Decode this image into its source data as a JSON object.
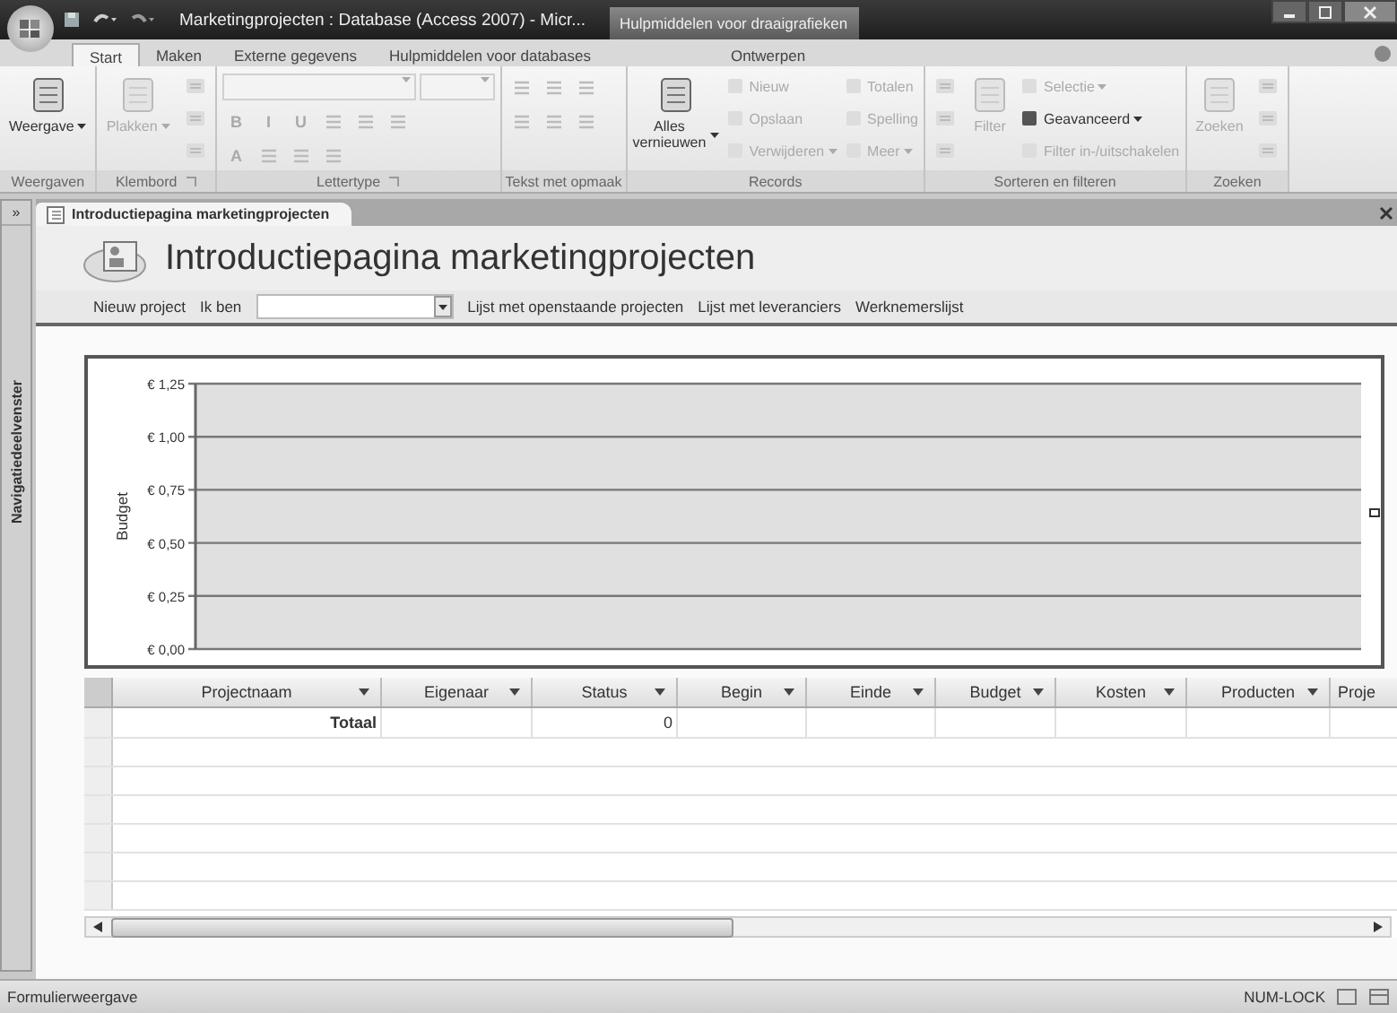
{
  "window": {
    "title": "Marketingprojecten : Database (Access 2007) - Micr...",
    "contextual_tab": "Hulpmiddelen voor draaigrafieken"
  },
  "ribbon_tabs": [
    {
      "label": "Start",
      "selected": true
    },
    {
      "label": "Maken",
      "selected": false
    },
    {
      "label": "Externe gegevens",
      "selected": false
    },
    {
      "label": "Hulpmiddelen voor databases",
      "selected": false
    },
    {
      "label": "Ontwerpen",
      "selected": false
    }
  ],
  "ribbon_groups": [
    {
      "label": "Weergaven",
      "launcher": false,
      "columns": [
        [
          {
            "kind": "large",
            "label": "Weergave",
            "dropdown": true,
            "disabled": false
          }
        ]
      ]
    },
    {
      "label": "Klembord",
      "launcher": true,
      "columns": [
        [
          {
            "kind": "large",
            "label": "Plakken",
            "dropdown": true,
            "disabled": true
          }
        ],
        [
          {
            "kind": "icon",
            "disabled": true
          },
          {
            "kind": "icon",
            "disabled": true
          },
          {
            "kind": "icon",
            "disabled": true
          }
        ]
      ]
    },
    {
      "label": "Lettertype",
      "launcher": true,
      "columns": [
        [
          {
            "kind": "toolrow",
            "items": [
              {
                "kind": "font-combo",
                "disabled": true
              },
              {
                "kind": "size-combo",
                "disabled": true
              }
            ]
          },
          {
            "kind": "toolrow",
            "items": [
              {
                "kind": "glyph",
                "text": "B",
                "disabled": true
              },
              {
                "kind": "glyph",
                "text": "I",
                "disabled": true
              },
              {
                "kind": "glyph",
                "text": "U",
                "disabled": true
              },
              {
                "kind": "icon",
                "disabled": true
              },
              {
                "kind": "icon",
                "disabled": true
              },
              {
                "kind": "icon",
                "disabled": true
              }
            ]
          },
          {
            "kind": "toolrow",
            "items": [
              {
                "kind": "glyph",
                "text": "A",
                "disabled": true
              },
              {
                "kind": "icon",
                "disabled": true
              },
              {
                "kind": "icon",
                "disabled": true
              },
              {
                "kind": "icon",
                "disabled": true
              }
            ]
          }
        ]
      ]
    },
    {
      "label": "Tekst met opmaak",
      "launcher": false,
      "columns": [
        [
          {
            "kind": "toolrow",
            "items": [
              {
                "kind": "icon",
                "disabled": true
              },
              {
                "kind": "icon",
                "disabled": true
              },
              {
                "kind": "icon",
                "disabled": true
              }
            ]
          },
          {
            "kind": "toolrow",
            "items": [
              {
                "kind": "icon",
                "disabled": true
              },
              {
                "kind": "icon",
                "disabled": true
              },
              {
                "kind": "icon",
                "disabled": true
              }
            ]
          }
        ]
      ]
    },
    {
      "label": "Records",
      "launcher": false,
      "columns": [
        [
          {
            "kind": "large",
            "label": "Alles vernieuwen",
            "dropdown": true,
            "disabled": false
          }
        ],
        [
          {
            "kind": "small",
            "label": "Nieuw",
            "dropdown": false,
            "disabled": true
          },
          {
            "kind": "small",
            "label": "Opslaan",
            "dropdown": false,
            "disabled": true
          },
          {
            "kind": "small",
            "label": "Verwijderen",
            "dropdown": true,
            "disabled": true
          }
        ],
        [
          {
            "kind": "small",
            "label": "Totalen",
            "dropdown": false,
            "disabled": true
          },
          {
            "kind": "small",
            "label": "Spelling",
            "dropdown": false,
            "disabled": true
          },
          {
            "kind": "small",
            "label": "Meer",
            "dropdown": true,
            "disabled": true
          }
        ]
      ]
    },
    {
      "label": "Sorteren en filteren",
      "launcher": false,
      "columns": [
        [
          {
            "kind": "icon",
            "disabled": true
          },
          {
            "kind": "icon",
            "disabled": true
          },
          {
            "kind": "icon",
            "disabled": true
          }
        ],
        [
          {
            "kind": "large",
            "label": "Filter",
            "dropdown": false,
            "disabled": true
          }
        ],
        [
          {
            "kind": "small",
            "label": "Selectie",
            "dropdown": true,
            "disabled": true
          },
          {
            "kind": "small",
            "label": "Geavanceerd",
            "dropdown": true,
            "disabled": false
          },
          {
            "kind": "small",
            "label": "Filter in-/uitschakelen",
            "dropdown": false,
            "disabled": true
          }
        ]
      ]
    },
    {
      "label": "Zoeken",
      "launcher": false,
      "columns": [
        [
          {
            "kind": "large",
            "label": "Zoeken",
            "dropdown": false,
            "disabled": true
          }
        ],
        [
          {
            "kind": "icon",
            "disabled": true
          },
          {
            "kind": "icon",
            "disabled": true
          },
          {
            "kind": "icon",
            "disabled": true
          }
        ]
      ]
    }
  ],
  "nav_pane": {
    "toggle": "»",
    "label": "Navigatiedeelvenster"
  },
  "document_tab": {
    "label": "Introductiepagina marketingprojecten"
  },
  "form": {
    "title": "Introductiepagina marketingprojecten",
    "links": [
      {
        "kind": "link",
        "label": "Nieuw project"
      },
      {
        "kind": "label",
        "label": "Ik ben"
      },
      {
        "kind": "combo"
      },
      {
        "kind": "link",
        "label": "Lijst met openstaande projecten"
      },
      {
        "kind": "link",
        "label": "Lijst met leveranciers"
      },
      {
        "kind": "link",
        "label": "Werknemerslijst"
      }
    ],
    "chart": {
      "chart_data": {
        "type": "bar",
        "categories": [
          null
        ],
        "values": [
          null
        ],
        "ylabel": "Budget",
        "grid": true,
        "ylim": [
          0,
          1.25
        ],
        "yticks": [
          {
            "value": 0,
            "label": "€ 0,00"
          },
          {
            "value": 0.25,
            "label": "€ 0,25"
          },
          {
            "value": 0.5,
            "label": "€ 0,50"
          },
          {
            "value": 0.75,
            "label": "€ 0,75"
          },
          {
            "value": 1,
            "label": "€ 1,00"
          },
          {
            "value": 1.25,
            "label": "€ 1,25"
          }
        ]
      }
    },
    "datasheet": {
      "columns": [
        {
          "header": "Projectnaam",
          "filter_arrow": true,
          "total": "Totaal"
        },
        {
          "header": "Eigenaar",
          "filter_arrow": true
        },
        {
          "header": "Status",
          "filter_arrow": true,
          "total": "0"
        },
        {
          "header": "Begin",
          "filter_arrow": true
        },
        {
          "header": "Einde",
          "filter_arrow": true
        },
        {
          "header": "Budget",
          "filter_arrow": true
        },
        {
          "header": "Kosten",
          "filter_arrow": true
        },
        {
          "header": "Producten",
          "filter_arrow": true
        },
        {
          "header": "Proje",
          "filter_arrow": false
        }
      ]
    }
  },
  "status_bar": {
    "view": "Formulierweergave",
    "indicator": "NUM-LOCK"
  }
}
